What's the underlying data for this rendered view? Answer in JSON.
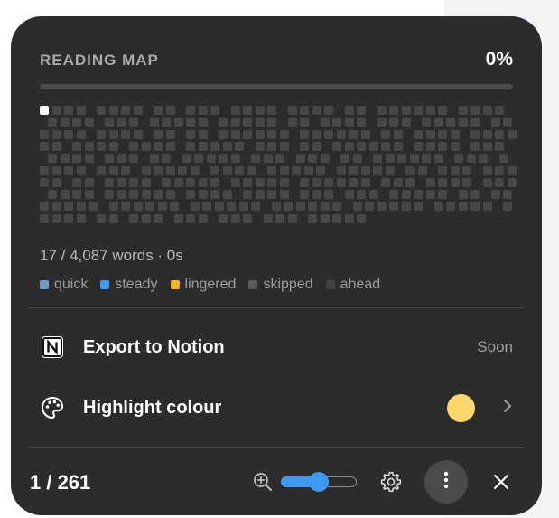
{
  "reading_map": {
    "title": "READING MAP",
    "percent_label": "0%",
    "progress": 0.0,
    "stats": "17 / 4,087 words · 0s",
    "legend": [
      {
        "label": "quick",
        "color": "#6d9ac4"
      },
      {
        "label": "steady",
        "color": "#3d9af3"
      },
      {
        "label": "lingered",
        "color": "#f3b52a"
      },
      {
        "label": "skipped",
        "color": "#5a5a5a"
      },
      {
        "label": "ahead",
        "color": "#444444"
      }
    ],
    "colors": {
      "current": "#ffffff",
      "ahead": "#474747"
    }
  },
  "menu": {
    "export": {
      "label": "Export to Notion",
      "status": "Soon",
      "icon": "notion-icon"
    },
    "highlight": {
      "label": "Highlight colour",
      "icon": "palette-icon",
      "swatch": "#fbd66a",
      "chevron": "chevron-right-icon"
    }
  },
  "toolbar": {
    "page_indicator": "1 / 261",
    "zoom_level": 0.5,
    "zoom_icon": "zoom-in-icon",
    "settings_icon": "gear-icon",
    "more_icon": "more-vertical-icon",
    "close_icon": "close-icon",
    "accent": "#3d9af3"
  }
}
